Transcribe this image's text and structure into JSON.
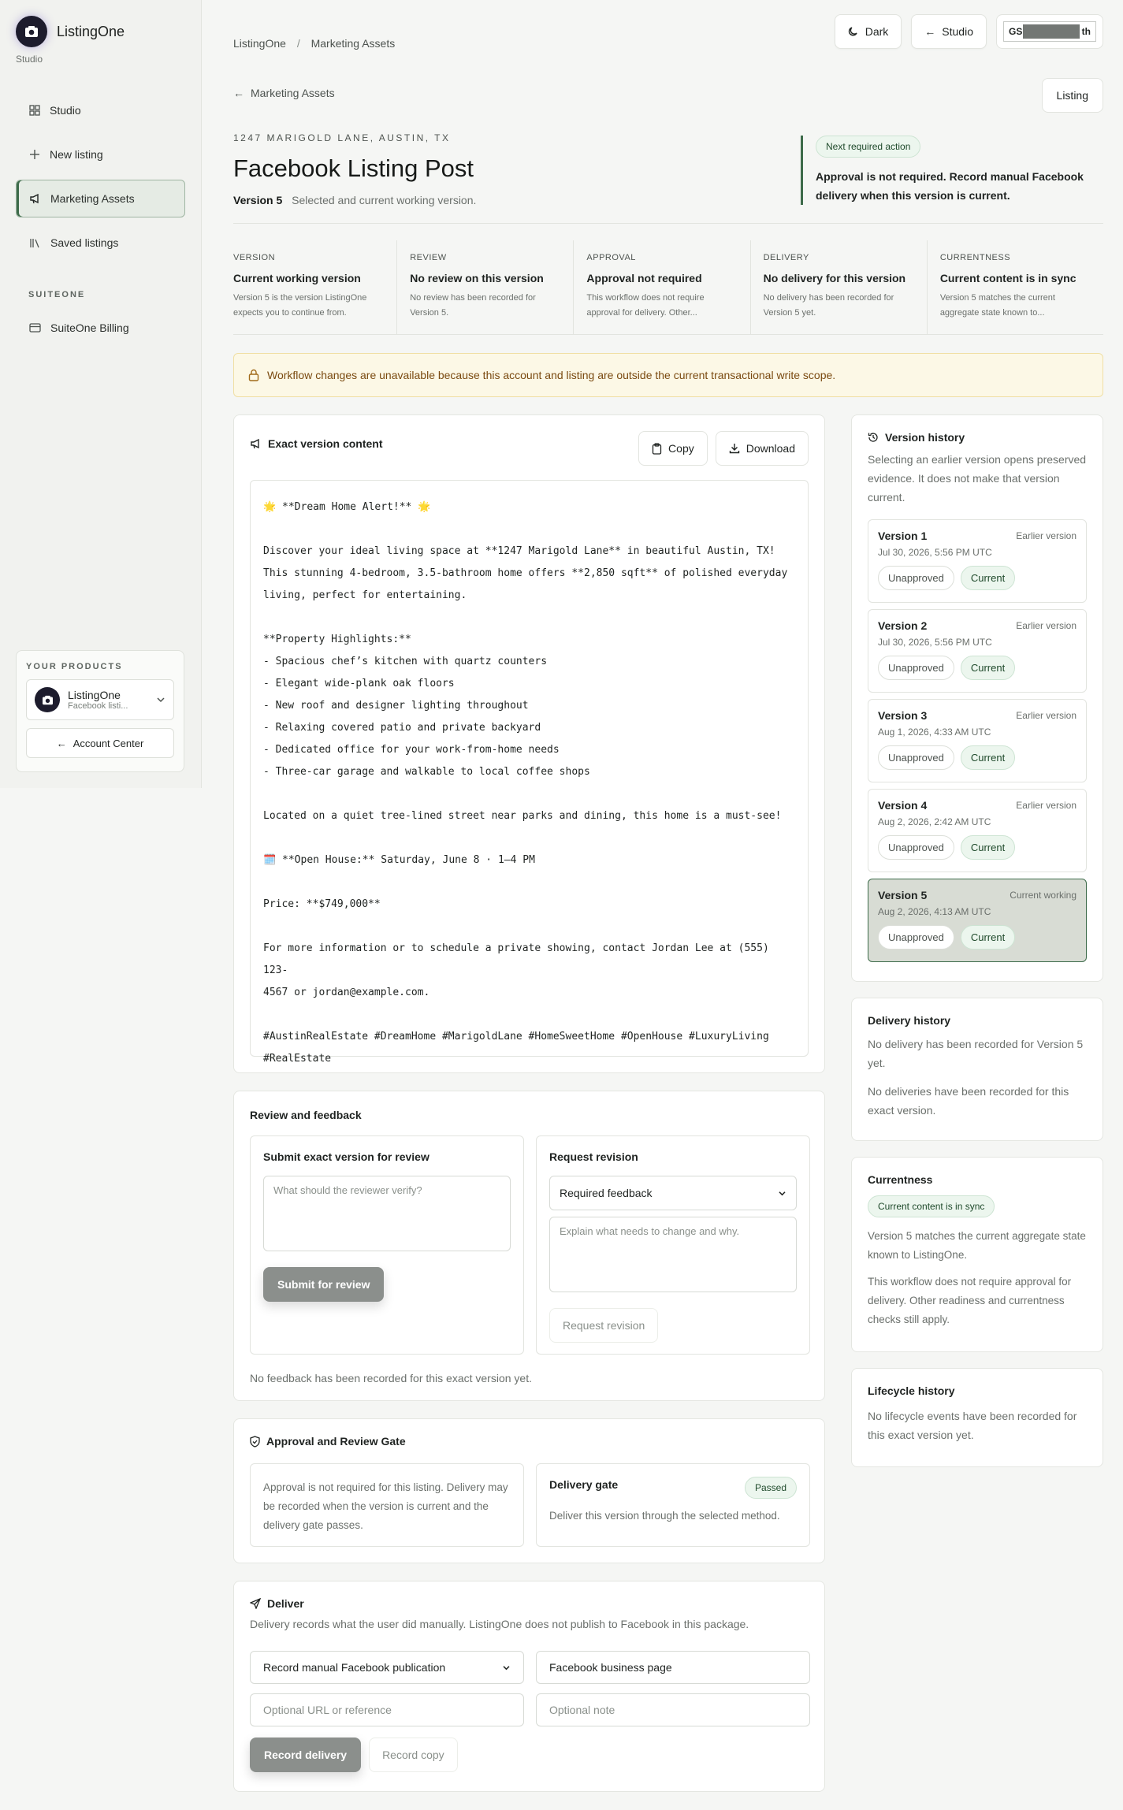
{
  "sidebar": {
    "brand": "ListingOne",
    "brand_sub": "Studio",
    "items": [
      {
        "label": "Studio"
      },
      {
        "label": "New listing"
      },
      {
        "label": "Marketing Assets"
      },
      {
        "label": "Saved listings"
      }
    ],
    "section": "SUITEONE",
    "section_items": [
      {
        "label": "SuiteOne Billing"
      }
    ],
    "products_title": "YOUR PRODUCTS",
    "product_name": "ListingOne",
    "product_sub": "Facebook listi...",
    "account_center": "Account Center"
  },
  "topbar": {
    "crumb_1": "ListingOne",
    "crumb_sep": "/",
    "crumb_2": "Marketing Assets",
    "dark_label": "Dark",
    "studio_label": "Studio",
    "user_prefix": "GS",
    "user_suffix": "th"
  },
  "nav": {
    "back_label": "Marketing Assets",
    "listing_label": "Listing"
  },
  "header": {
    "address": "1247 MARIGOLD LANE, AUSTIN, TX",
    "title": "Facebook Listing Post",
    "version": "Version 5",
    "version_desc": "Selected and current working version.",
    "next_pill": "Next required action",
    "next_text": "Approval is not required. Record manual Facebook delivery when this version is current."
  },
  "status": [
    {
      "label": "VERSION",
      "value": "Current working version",
      "desc": "Version 5 is the version ListingOne expects you to continue from."
    },
    {
      "label": "REVIEW",
      "value": "No review on this version",
      "desc": "No review has been recorded for Version 5."
    },
    {
      "label": "APPROVAL",
      "value": "Approval not required",
      "desc": "This workflow does not require approval for delivery. Other..."
    },
    {
      "label": "DELIVERY",
      "value": "No delivery for this version",
      "desc": "No delivery has been recorded for Version 5 yet."
    },
    {
      "label": "CURRENTNESS",
      "value": "Current content is in sync",
      "desc": "Version 5 matches the current aggregate state known to..."
    }
  ],
  "warning": "Workflow changes are unavailable because this account and listing are outside the current transactional write scope.",
  "content": {
    "title": "Exact version content",
    "copy_label": "Copy",
    "download_label": "Download",
    "lines": [
      "🌟 **Dream Home Alert!** 🌟",
      "",
      "Discover your ideal living space at **1247 Marigold Lane** in beautiful Austin, TX!",
      "This stunning 4-bedroom, 3.5-bathroom home offers **2,850 sqft** of polished everyday",
      "living, perfect for entertaining.",
      "",
      "**Property Highlights:**",
      "- Spacious chef’s kitchen with quartz counters",
      "- Elegant wide-plank oak floors",
      "- New roof and designer lighting throughout",
      "- Relaxing covered patio and private backyard",
      "- Dedicated office for your work-from-home needs",
      "- Three-car garage and walkable to local coffee shops",
      "",
      "Located on a quiet tree-lined street near parks and dining, this home is a must-see!",
      "",
      "🗓️ **Open House:** Saturday, June 8 · 1–4 PM",
      "",
      "Price: **$749,000**",
      "",
      "For more information or to schedule a private showing, contact Jordan Lee at (555) 123-",
      "4567 or jordan@example.com.",
      "",
      "#AustinRealEstate #DreamHome #MarigoldLane #HomeSweetHome #OpenHouse #LuxuryLiving",
      "#RealEstate"
    ]
  },
  "review": {
    "title": "Review and feedback",
    "submit_title": "Submit exact version for review",
    "submit_placeholder": "What should the reviewer verify?",
    "submit_button": "Submit for review",
    "revision_title": "Request revision",
    "revision_select": "Required feedback",
    "revision_placeholder": "Explain what needs to change and why.",
    "revision_button": "Request revision",
    "note": "No feedback has been recorded for this exact version yet."
  },
  "approval": {
    "title": "Approval and Review Gate",
    "left_text": "Approval is not required for this listing. Delivery may be recorded when the version is current and the delivery gate passes.",
    "gate_title": "Delivery gate",
    "gate_badge": "Passed",
    "gate_text": "Deliver this version through the selected method."
  },
  "deliver": {
    "title": "Deliver",
    "desc": "Delivery records what the user did manually. ListingOne does not publish to Facebook in this package.",
    "method": "Record manual Facebook publication",
    "destination": "Facebook business page",
    "url_placeholder": "Optional URL or reference",
    "note_placeholder": "Optional note",
    "record_button": "Record delivery",
    "copy_button": "Record copy"
  },
  "version_history": {
    "title": "Version history",
    "desc": "Selecting an earlier version opens preserved evidence. It does not make that version current.",
    "unapproved": "Unapproved",
    "current_tag": "Current",
    "items": [
      {
        "name": "Version 1",
        "state": "Earlier version",
        "date": "Jul 30, 2026, 5:56 PM UTC"
      },
      {
        "name": "Version 2",
        "state": "Earlier version",
        "date": "Jul 30, 2026, 5:56 PM UTC"
      },
      {
        "name": "Version 3",
        "state": "Earlier version",
        "date": "Aug 1, 2026, 4:33 AM UTC"
      },
      {
        "name": "Version 4",
        "state": "Earlier version",
        "date": "Aug 2, 2026, 2:42 AM UTC"
      },
      {
        "name": "Version 5",
        "state": "Current working",
        "date": "Aug 2, 2026, 4:13 AM UTC"
      }
    ]
  },
  "delivery_history": {
    "title": "Delivery history",
    "text_1": "No delivery has been recorded for Version 5 yet.",
    "text_2": "No deliveries have been recorded for this exact version."
  },
  "currentness": {
    "title": "Currentness",
    "badge": "Current content is in sync",
    "text_1": "Version 5 matches the current aggregate state known to ListingOne.",
    "text_2": "This workflow does not require approval for delivery. Other readiness and currentness checks still apply."
  },
  "lifecycle": {
    "title": "Lifecycle history",
    "text": "No lifecycle events have been recorded for this exact version yet."
  }
}
